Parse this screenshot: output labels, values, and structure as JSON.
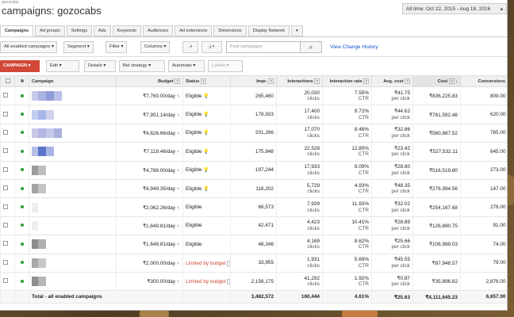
{
  "header": {
    "crumb": "gozocabs",
    "title": "campaigns: gozocabs",
    "date_range": "All time: Oct 22, 2015 - Aug 18, 2016"
  },
  "tabs": [
    "Campaigns",
    "Ad groups",
    "Settings",
    "Ads",
    "Keywords",
    "Audiences",
    "Ad extensions",
    "Dimensions",
    "Display Network"
  ],
  "filterbar": {
    "filter_select": "All enabled campaigns",
    "segment": "Segment",
    "filter": "Filter",
    "columns": "Columns",
    "search_placeholder": "Find campaigns",
    "change_history": "View Change History"
  },
  "actions": {
    "campaign": "CAMPAIGN",
    "edit": "Edit",
    "details": "Details",
    "bid_strategy": "Bid strategy",
    "automate": "Automate",
    "labels": "Labels"
  },
  "columns": [
    "Campaign",
    "Budget",
    "Status",
    "Impr.",
    "Interactions",
    "Interaction rate",
    "Avg. cost",
    "Cost",
    "Conversions"
  ],
  "rows": [
    {
      "budget": "₹7,760.00/day",
      "status": "Eligible",
      "impr": "265,460",
      "inter": "20,030",
      "inter_unit": "clicks",
      "rate": "7.55%",
      "rate_unit": "CTR",
      "avg": "₹41.75",
      "avg_unit": "per click",
      "cost": "₹836,225.83",
      "conv": "809.00"
    },
    {
      "budget": "₹7,951.14/day",
      "status": "Eligible",
      "impr": "178,933",
      "inter": "17,400",
      "inter_unit": "clicks",
      "rate": "9.72%",
      "rate_unit": "CTR",
      "avg": "₹44.62",
      "avg_unit": "per click",
      "cost": "₹781,592.46",
      "conv": "620.00"
    },
    {
      "budget": "₹4,626.66/day",
      "status": "Eligible",
      "impr": "201,266",
      "inter": "17,070",
      "inter_unit": "clicks",
      "rate": "8.48%",
      "rate_unit": "CTR",
      "avg": "₹32.86",
      "avg_unit": "per click",
      "cost": "₹560,887.52",
      "conv": "765.00"
    },
    {
      "budget": "₹7,119.46/day",
      "status": "Eligible",
      "impr": "175,948",
      "inter": "22,528",
      "inter_unit": "clicks",
      "rate": "12.80%",
      "rate_unit": "CTR",
      "avg": "₹23.42",
      "avg_unit": "per click",
      "cost": "₹527,532.11",
      "conv": "645.00"
    },
    {
      "budget": "₹4,788.00/day",
      "status": "Eligible",
      "impr": "197,244",
      "inter": "17,933",
      "inter_unit": "clicks",
      "rate": "9.09%",
      "rate_unit": "CTR",
      "avg": "₹28.80",
      "avg_unit": "per click",
      "cost": "₹516,519.80",
      "conv": "273.00"
    },
    {
      "budget": "₹4,949.35/day",
      "status": "Eligible",
      "impr": "116,202",
      "inter": "5,729",
      "inter_unit": "clicks",
      "rate": "4.93%",
      "rate_unit": "CTR",
      "avg": "₹48.35",
      "avg_unit": "per click",
      "cost": "₹276,994.56",
      "conv": "147.00"
    },
    {
      "budget": "₹2,062.26/day",
      "status": "Eligible",
      "impr": "66,573",
      "inter": "7,939",
      "inter_unit": "clicks",
      "rate": "11.93%",
      "rate_unit": "CTR",
      "avg": "₹32.02",
      "avg_unit": "per click",
      "cost": "₹254,167.68",
      "conv": "278.00"
    },
    {
      "budget": "₹1,649.81/day",
      "status": "Eligible",
      "impr": "42,471",
      "inter": "4,423",
      "inter_unit": "clicks",
      "rate": "10.41%",
      "rate_unit": "CTR",
      "avg": "₹28.89",
      "avg_unit": "per click",
      "cost": "₹126,890.75",
      "conv": "91.00"
    },
    {
      "budget": "₹1,649.81/day",
      "status": "Eligible",
      "impr": "48,346",
      "inter": "4,169",
      "inter_unit": "clicks",
      "rate": "8.62%",
      "rate_unit": "CTR",
      "avg": "₹25.66",
      "avg_unit": "per click",
      "cost": "₹106,989.03",
      "conv": "74.00"
    },
    {
      "budget": "₹2,000.00/day",
      "status": "Limited by budget",
      "impr": "33,955",
      "inter": "1,931",
      "inter_unit": "clicks",
      "rate": "5.69%",
      "rate_unit": "CTR",
      "avg": "₹45.55",
      "avg_unit": "per click",
      "cost": "₹87,948.57",
      "conv": "79.00"
    },
    {
      "budget": "₹300.00/day",
      "status": "Limited by budget",
      "impr": "2,156,175",
      "inter": "41,292",
      "inter_unit": "clicks",
      "rate": "1.92%",
      "rate_unit": "CTR",
      "avg": "₹0.87",
      "avg_unit": "per click",
      "cost": "₹35,896.82",
      "conv": "2,876.00"
    }
  ],
  "total": {
    "label": "Total - all enabled campaigns",
    "impr": "3,482,572",
    "inter": "160,444",
    "rate": "4.61%",
    "avg": "₹25.63",
    "cost": "₹4,111,645.23",
    "conv": "6,657.00"
  },
  "colors": {
    "accent": "#d14836",
    "link": "#1155cc",
    "eligible": "#2a9d3a",
    "bulb": "#e6b800"
  },
  "blur_colors": [
    [
      "#c6c9e8",
      "#a9b3e0",
      "#8f9bd8",
      "#b9bfe6"
    ],
    [
      "#c2cdef",
      "#a6b6ea",
      "#d0d4ee"
    ],
    [
      "#c9c8e6",
      "#b2b7e2",
      "#c4c8ea",
      "#aab0de"
    ],
    [
      "#b7c0e8",
      "#5a74c9",
      "#a8b5e6"
    ],
    [
      "#9b9b9b",
      "#bdbdbd"
    ],
    [
      "#a3a3a3",
      "#c4c4c4"
    ],
    [
      "#ededed"
    ],
    [
      "#eeeeee"
    ],
    [
      "#8e8e8e",
      "#b0b0b0"
    ],
    [
      "#a8a8a8",
      "#c8c8c8"
    ],
    [
      "#8f8f8f",
      "#b5b5b5"
    ]
  ]
}
